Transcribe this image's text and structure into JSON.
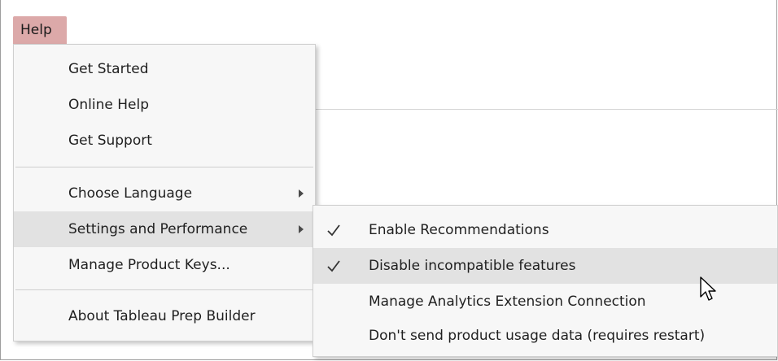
{
  "menubar": {
    "help_label": "Help"
  },
  "help_menu": {
    "items": [
      {
        "label": "Get Started"
      },
      {
        "label": "Online Help"
      },
      {
        "label": "Get Support"
      },
      {
        "label": "Choose Language",
        "has_submenu": true
      },
      {
        "label": "Settings and Performance",
        "has_submenu": true,
        "highlighted": true
      },
      {
        "label": "Manage Product Keys..."
      },
      {
        "label": "About Tableau Prep Builder"
      }
    ]
  },
  "settings_submenu": {
    "items": [
      {
        "label": "Enable Recommendations",
        "checked": true
      },
      {
        "label": "Disable incompatible features",
        "checked": true,
        "highlighted": true
      },
      {
        "label": "Manage Analytics Extension Connection",
        "checked": false
      },
      {
        "label": "Don't send product usage data (requires restart)",
        "checked": false
      }
    ]
  },
  "colors": {
    "menubar_active": "#dca9a9",
    "menu_background": "#f7f7f7",
    "menu_highlight": "#e2e2e2"
  },
  "icons": {
    "submenu_arrow": "chevron-right-icon",
    "checkmark": "checkmark-icon",
    "cursor": "mouse-pointer-icon"
  }
}
